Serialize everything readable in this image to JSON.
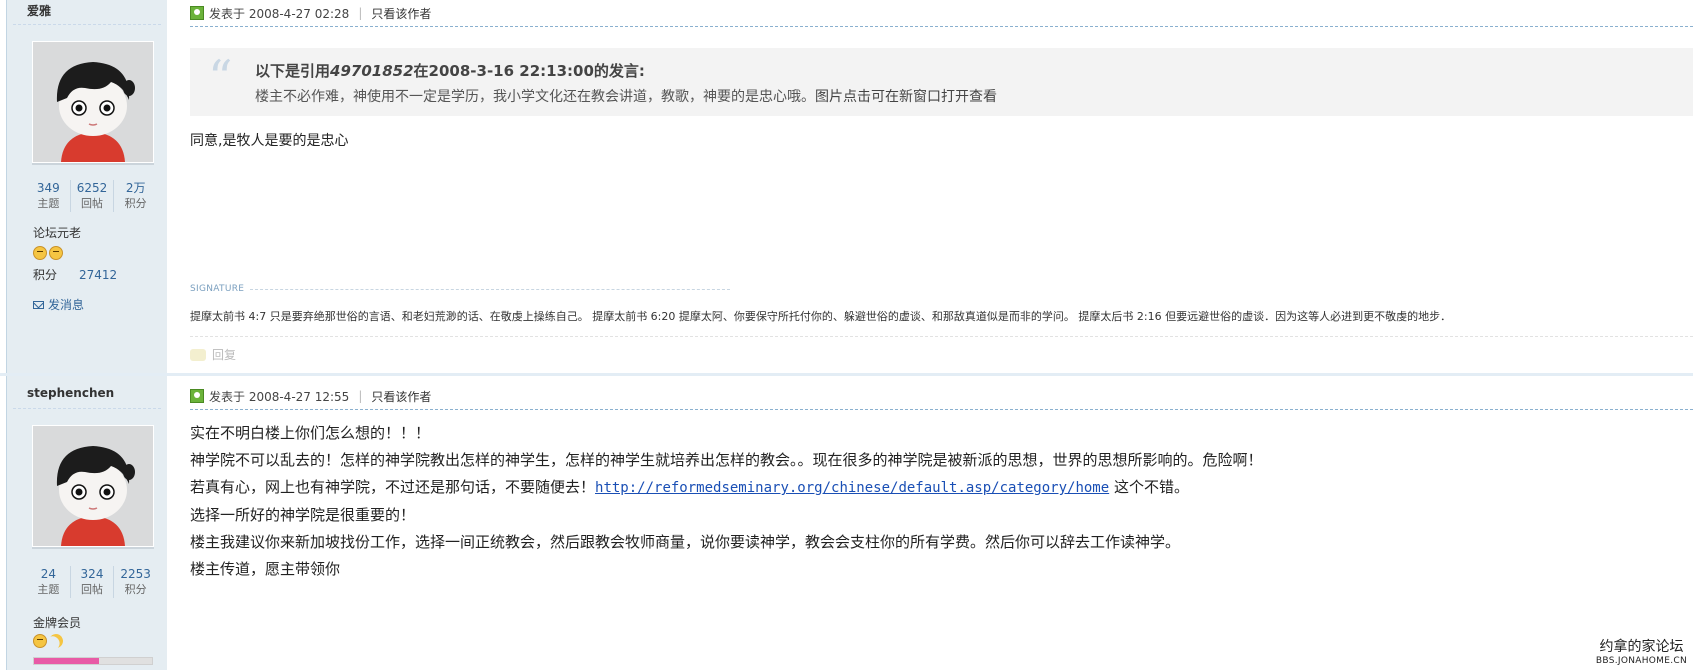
{
  "posts": [
    {
      "author": "爱雅",
      "stats": [
        {
          "num": "349",
          "label": "主题"
        },
        {
          "num": "6252",
          "label": "回帖"
        },
        {
          "num": "2万",
          "label": "积分"
        }
      ],
      "rank": "论坛元老",
      "credit_label": "积分",
      "credit_value": "27412",
      "message_label": "发消息",
      "time": "发表于 2008-4-27 02:28",
      "only_author": "只看该作者",
      "quote": {
        "prefix": "以下是引用",
        "quoted_user": "49701852",
        "in": "在",
        "date": "2008-3-16 22:13:00",
        "suffix": "的发言:",
        "body": "楼主不必作难，神使用不一定是学历，我小学文化还在教会讲道，教歌，神要的是忠心哦。",
        "img_alt": "图片点击可在新窗口打开查看"
      },
      "content": "同意,是牧人是要的是忠心",
      "signature_label": "SIGNATURE",
      "signature": "提摩太前书 4:7 只是要弃绝那世俗的言语、和老妇荒渺的话、在敬虔上操练自己。 提摩太前书 6:20 提摩太阿、你要保守所托付你的、躲避世俗的虚谈、和那敌真道似是而非的学问。 提摩太后书 2:16 但要远避世俗的虚谈．因为这等人必进到更不敬虔的地步．",
      "reply_label": "回复"
    },
    {
      "author": "stephenchen",
      "stats": [
        {
          "num": "24",
          "label": "主题"
        },
        {
          "num": "324",
          "label": "回帖"
        },
        {
          "num": "2253",
          "label": "积分"
        }
      ],
      "rank": "金牌会员",
      "progress": 0.55,
      "time": "发表于 2008-4-27 12:55",
      "only_author": "只看该作者",
      "lines": [
        "实在不明白楼上你们怎么想的！！！",
        "神学院不可以乱去的！怎样的神学院教出怎样的神学生，怎样的神学生就培养出怎样的教会。。现在很多的神学院是被新派的思想，世界的思想所影响的。危险啊！"
      ],
      "line3_prefix": "若真有心，网上也有神学院，不过还是那句话，不要随便去！",
      "link": "http://reformedseminary.org/chinese/default.asp/category/home",
      "line3_suffix": " 这个不错。",
      "lines_after": [
        "选择一所好的神学院是很重要的！",
        "楼主我建议你来新加坡找份工作，选择一间正统教会，然后跟教会牧师商量，说你要读神学，教会会支柱你的所有学费。然后你可以辞去工作读神学。",
        "楼主传道，愿主带领你"
      ]
    }
  ],
  "watermark": {
    "title": "约拿的家论坛",
    "url": "BBS.JONAHOME.CN"
  }
}
